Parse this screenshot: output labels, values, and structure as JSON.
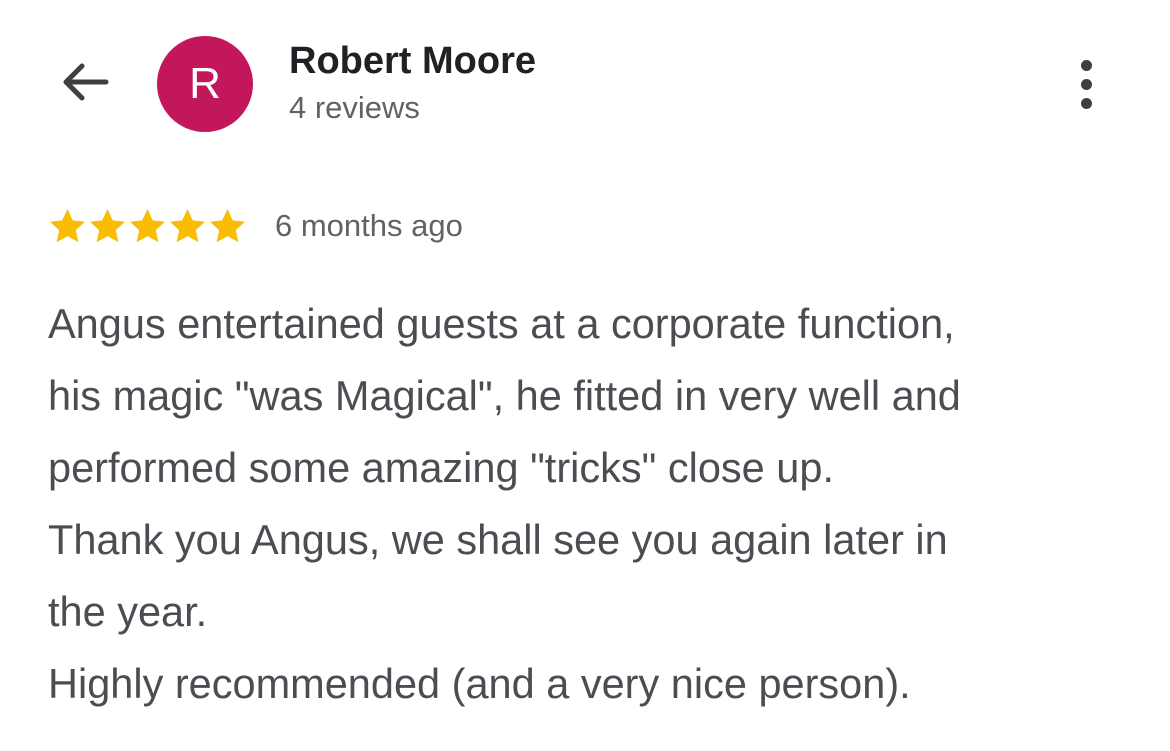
{
  "header": {
    "back_icon": "arrow-left-icon",
    "avatar_initial": "R",
    "avatar_color": "#c2185b",
    "name": "Robert Moore",
    "reviews_count": "4 reviews",
    "menu_icon": "more-vertical-icon"
  },
  "review": {
    "rating": 5,
    "rating_max": 5,
    "star_color": "#fbbc04",
    "time": "6 months ago",
    "lines": [
      "Angus entertained guests at a corporate function,",
      "his magic \"was Magical\", he fitted in very well and",
      "performed some amazing \"tricks\" close up.",
      "Thank you Angus, we shall see you again later in",
      "the year.",
      "Highly recommended (and a very nice person)."
    ]
  }
}
